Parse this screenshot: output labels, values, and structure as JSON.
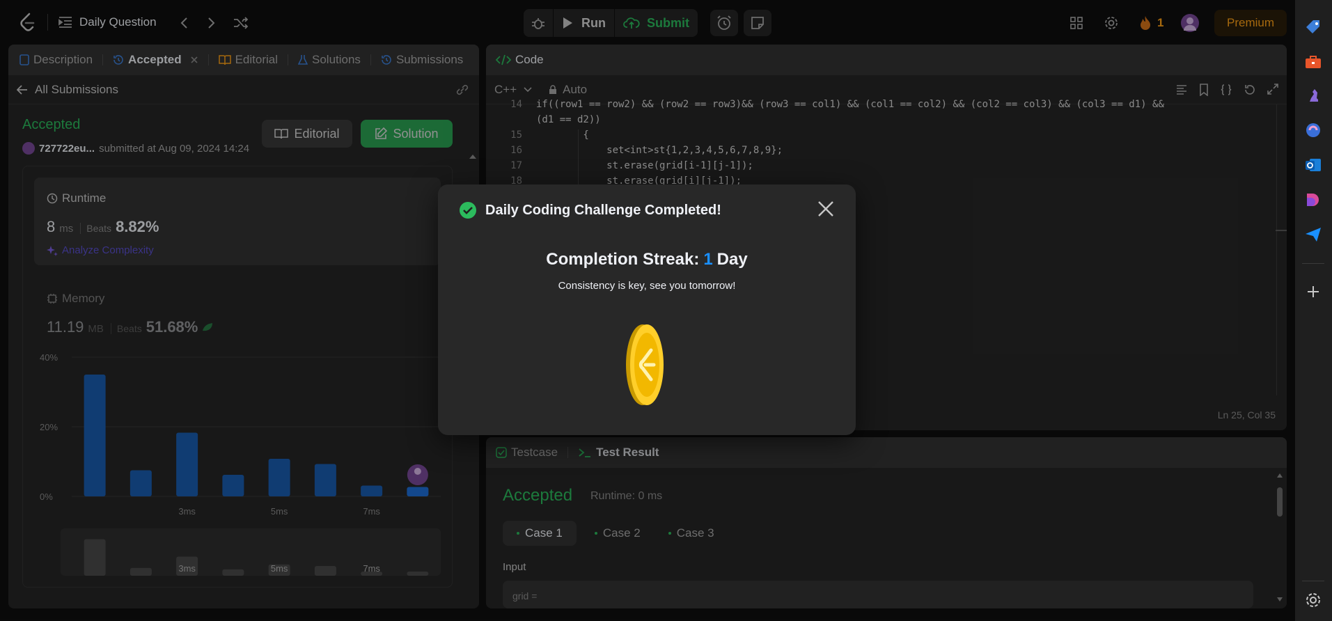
{
  "topbar": {
    "title": "Daily Question",
    "run_label": "Run",
    "submit_label": "Submit",
    "streak_count": "1",
    "premium_label": "Premium"
  },
  "left_panel": {
    "tabs": [
      {
        "label": "Description",
        "icon": "document-icon"
      },
      {
        "label": "Accepted",
        "icon": "history-icon"
      },
      {
        "label": "Editorial",
        "icon": "book-icon"
      },
      {
        "label": "Solutions",
        "icon": "flask-icon"
      },
      {
        "label": "Submissions",
        "icon": "history-icon"
      }
    ],
    "back_label": "All Submissions",
    "status": "Accepted",
    "username": "727722eu...",
    "submitted_text": "submitted at Aug 09, 2024 14:24",
    "editorial_button": "Editorial",
    "solution_button": "Solution",
    "runtime": {
      "title": "Runtime",
      "value": "8",
      "unit": "ms",
      "beats_label": "Beats",
      "beats_pct": "8.82%",
      "analyze_label": "Analyze Complexity"
    },
    "memory": {
      "title": "Memory",
      "value": "11.19",
      "unit": "MB",
      "beats_label": "Beats",
      "beats_pct": "51.68%"
    }
  },
  "chart_data": {
    "type": "bar",
    "y_ticks": [
      "40%",
      "20%",
      "0%"
    ],
    "x_tick_labels": [
      "3ms",
      "5ms",
      "7ms"
    ],
    "values": [
      35,
      7.5,
      18.3,
      6.2,
      10.8,
      9.3,
      3.1,
      2.7
    ],
    "ylim": [
      0,
      40
    ],
    "minimap_labels": [
      "3ms",
      "5ms",
      "7ms"
    ]
  },
  "code_panel": {
    "title": "Code",
    "language": "C++",
    "mode": "Auto",
    "cursor_pos": "Ln 25, Col 35",
    "lines": [
      {
        "n": "14",
        "text": "if((row1 == row2) && (row2 == row3)&& (row3 == col1) && (col1 == col2) && (col2 == col3) && (col3 == d1) &&"
      },
      {
        "n": "",
        "text": "(d1 == d2))"
      },
      {
        "n": "15",
        "text": "        {"
      },
      {
        "n": "16",
        "text": "            set<int>st{1,2,3,4,5,6,7,8,9};"
      },
      {
        "n": "17",
        "text": "            st.erase(grid[i-1][j-1]);"
      },
      {
        "n": "18",
        "text": "            st.erase(grid[i][j-1]);"
      }
    ]
  },
  "test_panel": {
    "tabs": [
      "Testcase",
      "Test Result"
    ],
    "status": "Accepted",
    "runtime_text": "Runtime: 0 ms",
    "cases": [
      "Case 1",
      "Case 2",
      "Case 3"
    ],
    "input_label": "Input",
    "input_value": "grid ="
  },
  "modal": {
    "title": "Daily Coding Challenge Completed!",
    "streak_label": "Completion Streak:",
    "streak_value": "1",
    "streak_unit": "Day",
    "message": "Consistency is key, see you tomorrow!"
  },
  "colors": {
    "accent_green": "#2cbb5d",
    "accent_orange": "#ffa116",
    "bar_blue": "#1a5cb0",
    "streak_blue": "#1a90ff"
  }
}
